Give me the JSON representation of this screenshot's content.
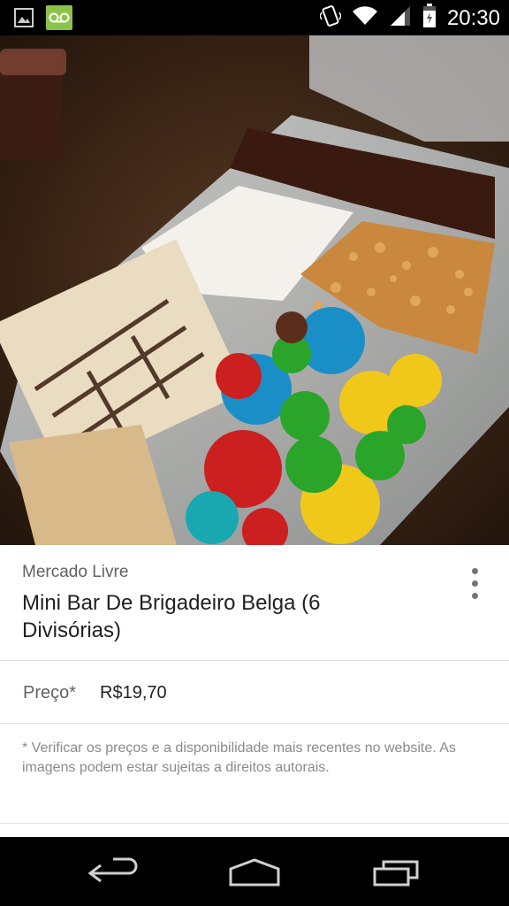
{
  "status_bar": {
    "time": "20:30",
    "left_icons": [
      "image-notification-icon",
      "voicemail-icon"
    ],
    "right_icons": [
      "vibrate-icon",
      "wifi-icon",
      "signal-icon",
      "battery-icon"
    ]
  },
  "product_image": {
    "description_icon": "product-photo"
  },
  "card": {
    "merchant": "Mercado Livre",
    "title": "Mini Bar De Brigadeiro Belga (6 Divisórias)",
    "price_label": "Preço*",
    "price_value": "R$19,70",
    "disclaimer": "* Verificar os preços e a disponibilidade mais recentes no website. As imagens podem estar sujeitas a direitos autorais."
  },
  "nav_bar": {
    "buttons": [
      "back-icon",
      "home-icon",
      "recent-apps-icon"
    ]
  },
  "colors": {
    "status_bar_bg": "#000000",
    "card_bg": "#ffffff",
    "voicemail_badge": "#8bc34a"
  }
}
